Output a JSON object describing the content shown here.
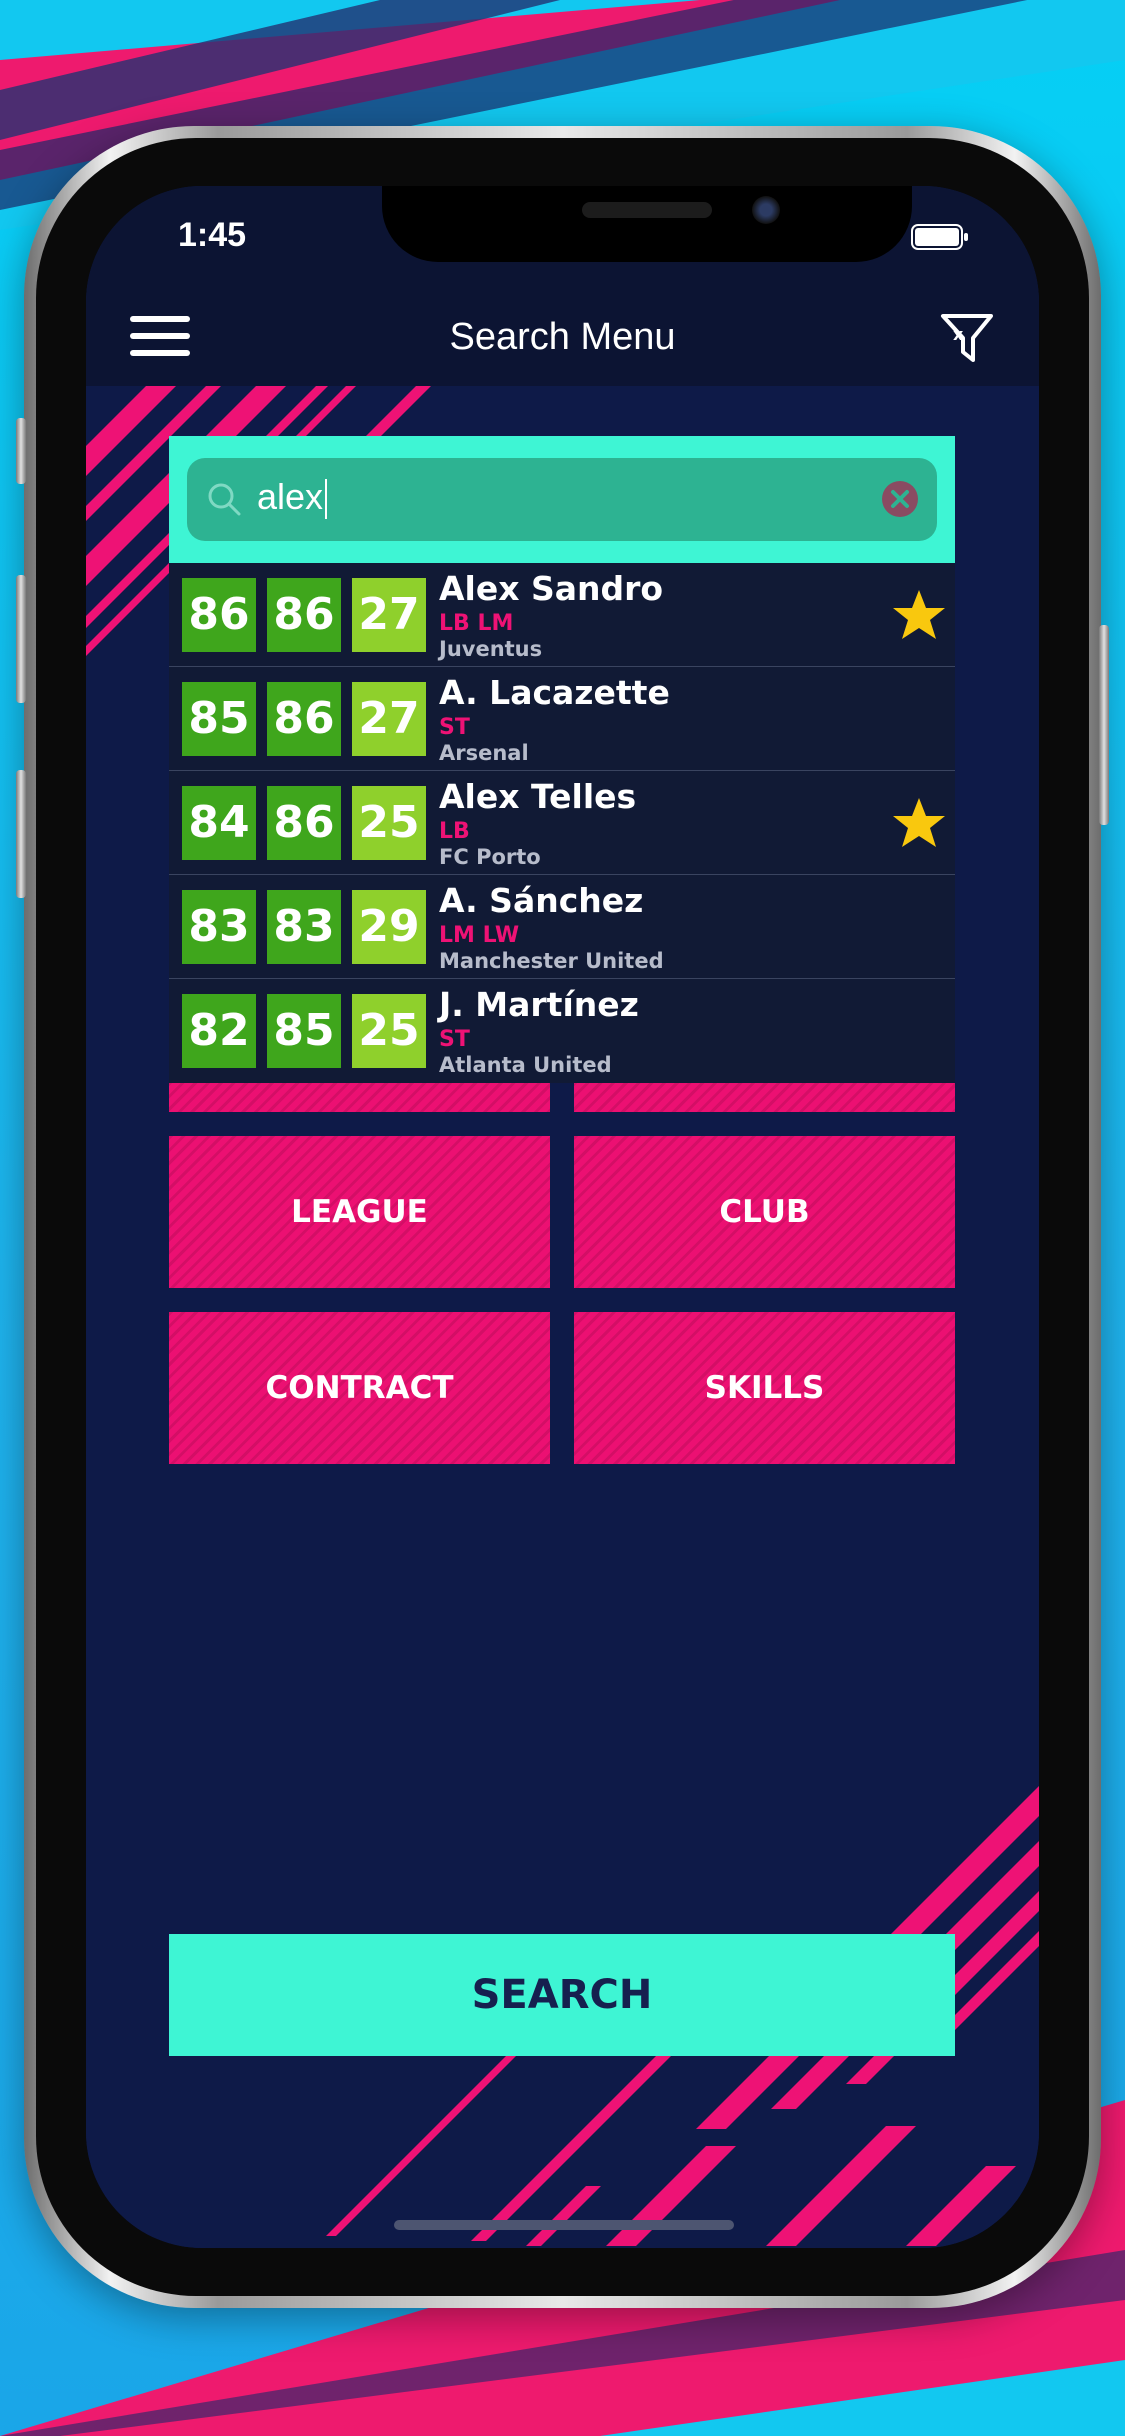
{
  "status_bar": {
    "time": "1:45"
  },
  "nav": {
    "title": "Search Menu"
  },
  "search": {
    "query": "alex"
  },
  "results": [
    {
      "stat1": "86",
      "stat2": "86",
      "stat3": "27",
      "name": "Alex Sandro",
      "positions": "LB LM",
      "club": "Juventus",
      "favorite": true
    },
    {
      "stat1": "85",
      "stat2": "86",
      "stat3": "27",
      "name": "A. Lacazette",
      "positions": "ST",
      "club": "Arsenal",
      "favorite": false
    },
    {
      "stat1": "84",
      "stat2": "86",
      "stat3": "25",
      "name": "Alex Telles",
      "positions": "LB",
      "club": "FC Porto",
      "favorite": true
    },
    {
      "stat1": "83",
      "stat2": "83",
      "stat3": "29",
      "name": "A. Sánchez",
      "positions": "LM LW",
      "club": "Manchester United",
      "favorite": false
    },
    {
      "stat1": "82",
      "stat2": "85",
      "stat3": "25",
      "name": "J. Martínez",
      "positions": "ST",
      "club": "Atlanta United",
      "favorite": false
    }
  ],
  "filters": {
    "league": "LEAGUE",
    "club": "CLUB",
    "contract": "CONTRACT",
    "skills": "SKILLS"
  },
  "search_button": "SEARCH",
  "colors": {
    "accent_teal": "#3ef5d4",
    "accent_pink": "#ec1072",
    "background_navy": "#0e1a48",
    "stat_green": "#3fa61c",
    "stat_light_green": "#8fd02c",
    "star_gold": "#f9c80e"
  }
}
